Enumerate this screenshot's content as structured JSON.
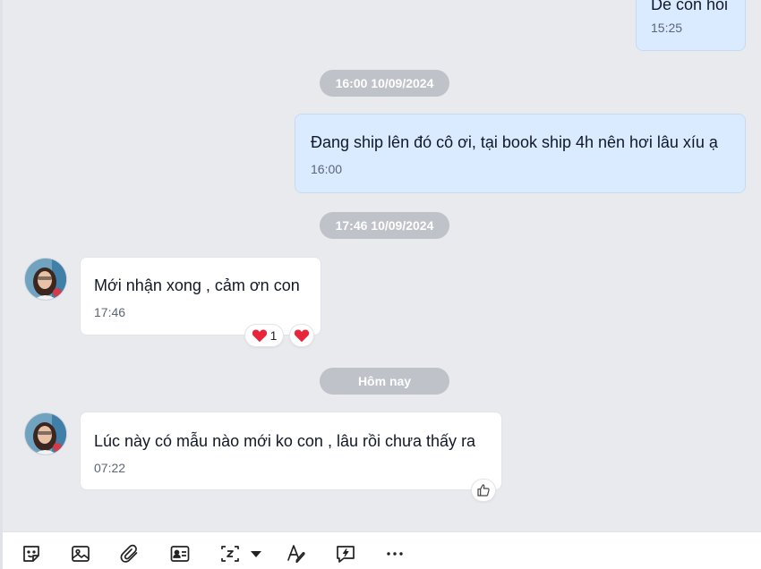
{
  "messages": {
    "top_partial": {
      "text": "Dễ con hỏi",
      "time": "15:25"
    },
    "date1": "16:00 10/09/2024",
    "msg_shipping": {
      "text": "Đang ship lên đó cô ơi, tại book ship 4h nên hơi lâu xíu ạ",
      "time": "16:00"
    },
    "date2": "17:46 10/09/2024",
    "msg_received": {
      "text": "Mới nhận xong , cảm ơn con",
      "time": "17:46",
      "reaction_count": "1"
    },
    "date3": "Hôm nay",
    "msg_today": {
      "text": "Lúc này có mẫu nào mới ko con , lâu rồi chưa thấy ra",
      "time": "07:22"
    }
  },
  "colors": {
    "outgoing_bubble": "#dbebff",
    "incoming_bubble": "#ffffff",
    "chat_background": "#e9eaee",
    "date_pill": "#bfc2c8",
    "heart": "#e8253b"
  },
  "toolbar": {
    "icons": [
      "sticker-icon",
      "image-icon",
      "attachment-icon",
      "contact-card-icon",
      "screenshot-icon",
      "dropdown-arrow-icon",
      "text-format-icon",
      "quick-message-icon",
      "more-icon"
    ]
  }
}
